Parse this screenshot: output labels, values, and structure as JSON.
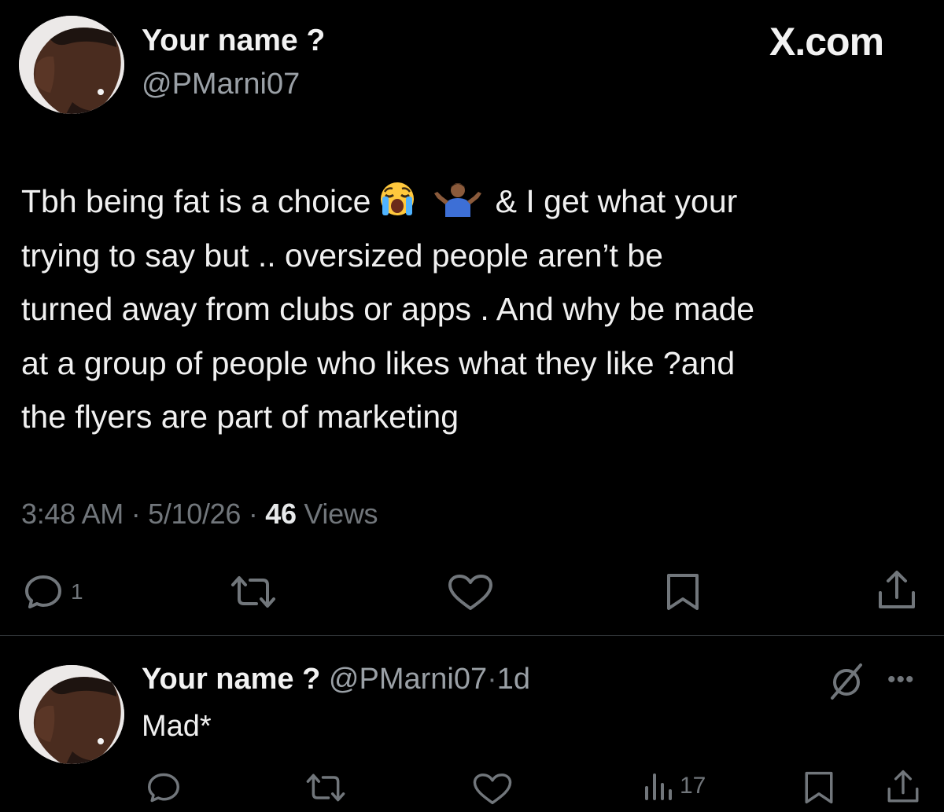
{
  "header": {
    "display_name": "Your name ?",
    "handle": "@PMarni07",
    "site_logo": "X.com"
  },
  "tweet": {
    "lines": [
      {
        "before": "Tbh being fat is a choice",
        "after": "& I get what your"
      },
      {
        "text": "trying to say but .. oversized people aren’t be"
      },
      {
        "text": "turned away from clubs or apps . And why be made"
      },
      {
        "text": "at a group of people who likes what they like ?and"
      },
      {
        "text": "the flyers are part of marketing"
      }
    ],
    "emojis": [
      "loudly-crying-face",
      "man-shrugging"
    ],
    "time": "3:48 AM",
    "date": "5/10/26",
    "views_count": "46",
    "views_label": "Views",
    "separator": "·",
    "reply_count": "1"
  },
  "reply": {
    "display_name": "Your name ?",
    "handle": "@PMarni07",
    "separator": "·",
    "age": "1d",
    "text": "Mad*",
    "views_count": "17",
    "more_label": "•••"
  },
  "icons": {
    "main_actions": [
      "reply-icon",
      "retweet-icon",
      "like-icon",
      "bookmark-icon",
      "share-icon"
    ],
    "reply_actions": [
      "reply-icon",
      "retweet-icon",
      "like-icon",
      "views-icon",
      "bookmark-icon",
      "share-icon"
    ],
    "reply_header": [
      "grok-icon",
      "more-icon"
    ]
  },
  "colors": {
    "background": "#000000",
    "text": "#e7e9ea",
    "muted": "#71767b",
    "divider": "#2f3336"
  }
}
